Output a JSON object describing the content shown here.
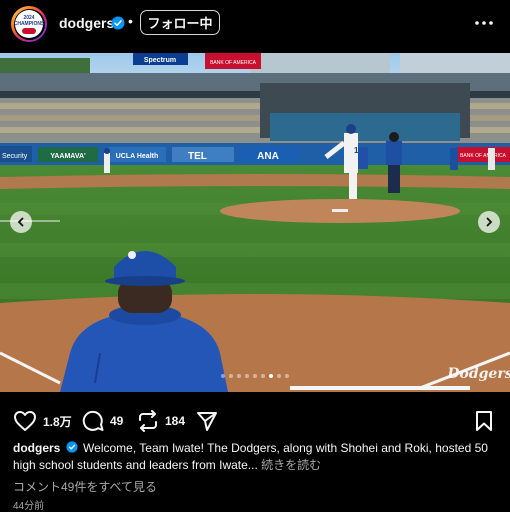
{
  "header": {
    "avatar_text_top": "2024",
    "avatar_text_main": "CHAMPIONS",
    "username": "dodgers",
    "separator": "•",
    "follow_label": "フォロー中"
  },
  "photo": {
    "sign_spectrum": "Spectrum",
    "sign_yaamava": "YAAMAVA'",
    "sign_ucla": "UCLA Health",
    "sign_tel": "TEL",
    "sign_ana": "ANA",
    "sign_bank": "BANK OF AMERICA",
    "sign_left": "Security",
    "jersey_number": "17",
    "watermark": "Dodgers"
  },
  "carousel": {
    "dot_count": 9,
    "active_index": 6
  },
  "actions": {
    "likes": "1.8万",
    "comments": "49",
    "reposts": "184"
  },
  "caption": {
    "username": "dodgers",
    "text": "Welcome, Team Iwate! The Dodgers, along with Shohei and Roki, hosted 50 high school students and leaders from Iwate...",
    "more_label": "続きを読む"
  },
  "comments_link": "コメント49件をすべて見る",
  "timestamp": "44分前",
  "colors": {
    "verified": "#0095f6",
    "dodger_blue": "#005a9c",
    "grass": "#3d7a2a",
    "dirt": "#b5774a"
  }
}
